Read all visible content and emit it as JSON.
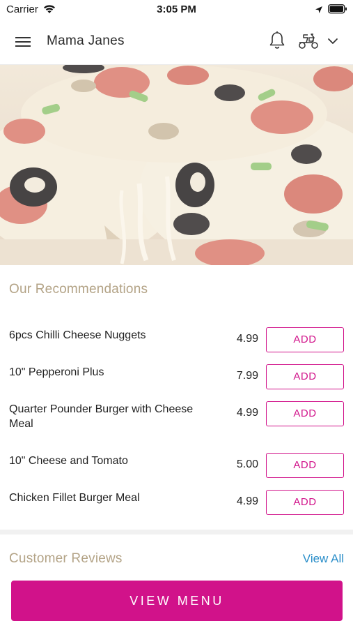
{
  "status_bar": {
    "carrier": "Carrier",
    "time": "3:05 PM"
  },
  "header": {
    "title": "Mama Janes"
  },
  "recommendations": {
    "title": "Our Recommendations",
    "items": [
      {
        "name": "6pcs Chilli Cheese Nuggets",
        "price": "4.99",
        "action": "ADD"
      },
      {
        "name": "10\" Pepperoni Plus",
        "price": "7.99",
        "action": "ADD"
      },
      {
        "name": "Quarter Pounder Burger  with Cheese Meal",
        "price": "4.99",
        "action": "ADD"
      },
      {
        "name": "10\" Cheese and Tomato",
        "price": "5.00",
        "action": "ADD"
      },
      {
        "name": "Chicken Fillet Burger Meal",
        "price": "4.99",
        "action": "ADD"
      }
    ]
  },
  "reviews": {
    "title": "Customer Reviews",
    "view_all": "View All"
  },
  "footer": {
    "view_menu": "VIEW MENU"
  },
  "colors": {
    "accent": "#d1128a",
    "section_title": "#b3a386",
    "link": "#2a8ec9"
  },
  "icons": [
    "wifi-icon",
    "location-arrow-icon",
    "battery-icon",
    "hamburger-menu-icon",
    "bell-icon",
    "scooter-icon",
    "chevron-down-icon"
  ]
}
